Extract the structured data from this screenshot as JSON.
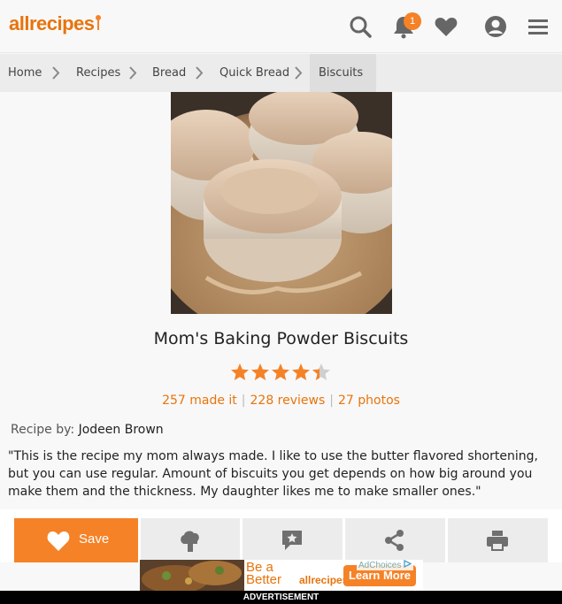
{
  "header": {
    "logo": "allrecipes",
    "notification_count": "1"
  },
  "breadcrumb": {
    "items": [
      "Home",
      "Recipes",
      "Bread",
      "Quick Bread",
      "Biscuits"
    ]
  },
  "recipe": {
    "title": "Mom's Baking Powder Biscuits",
    "rating": 4.5,
    "made_it": "257 made it",
    "reviews": "228 reviews",
    "photos": "27 photos",
    "byline_label": "Recipe by:",
    "author": "Jodeen Brown",
    "description": "\"This is the recipe my mom always made. I like to use the butter flavored shortening, but you can use regular. Amount of biscuits you get depends on how big around you make them and the thickness. My daughter likes me to make smaller ones.\""
  },
  "actions": {
    "save_label": "Save"
  },
  "ad": {
    "headline": "Be a Better",
    "brand": "allrecipes",
    "cta": "Learn More",
    "choices": "AdChoices",
    "label": "ADVERTISEMENT"
  },
  "colors": {
    "accent": "#f58227",
    "brand": "#e8740c"
  },
  "icons": [
    "search-icon",
    "bell-icon",
    "heart-icon",
    "account-icon",
    "menu-icon",
    "chevron-right-icon",
    "star-icon",
    "chef-hat-icon",
    "review-icon",
    "share-icon",
    "print-icon"
  ]
}
